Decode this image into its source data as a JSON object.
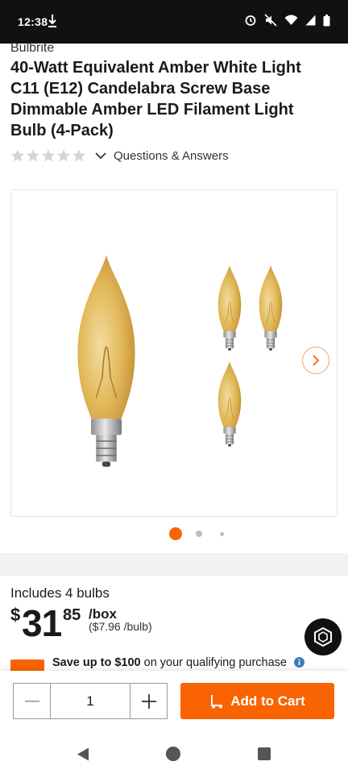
{
  "status_bar": {
    "time": "12:38",
    "left_icons": [
      "download-icon"
    ],
    "right_icons": [
      "alarm-icon",
      "mute-icon",
      "wifi-icon",
      "signal-icon",
      "battery-icon"
    ]
  },
  "product": {
    "brand": "Bulbrite",
    "title": "40-Watt Equivalent Amber White Light C11 (E12) Candelabra Screw Base Dimmable Amber LED Filament Light Bulb (4-Pack)",
    "rating": {
      "stars_filled": 0,
      "stars_total": 5
    },
    "qa_link": "Questions & Answers"
  },
  "gallery": {
    "image_count": 3,
    "active_index": 0,
    "next_icon": "chevron-right-icon"
  },
  "pricing": {
    "includes": "Includes 4 bulbs",
    "currency": "$",
    "dollars": "31",
    "cents": "85",
    "unit": "/box",
    "per_unit": "($7.96 /bulb)"
  },
  "promo": {
    "bold_text": "Save up to $100",
    "rest_text": " on your qualifying purchase"
  },
  "cart": {
    "quantity": "1",
    "add_label": "Add to Cart"
  },
  "colors": {
    "accent": "#f96302",
    "status_bar": "#111111",
    "bulb_amber": "#e2b95a"
  }
}
